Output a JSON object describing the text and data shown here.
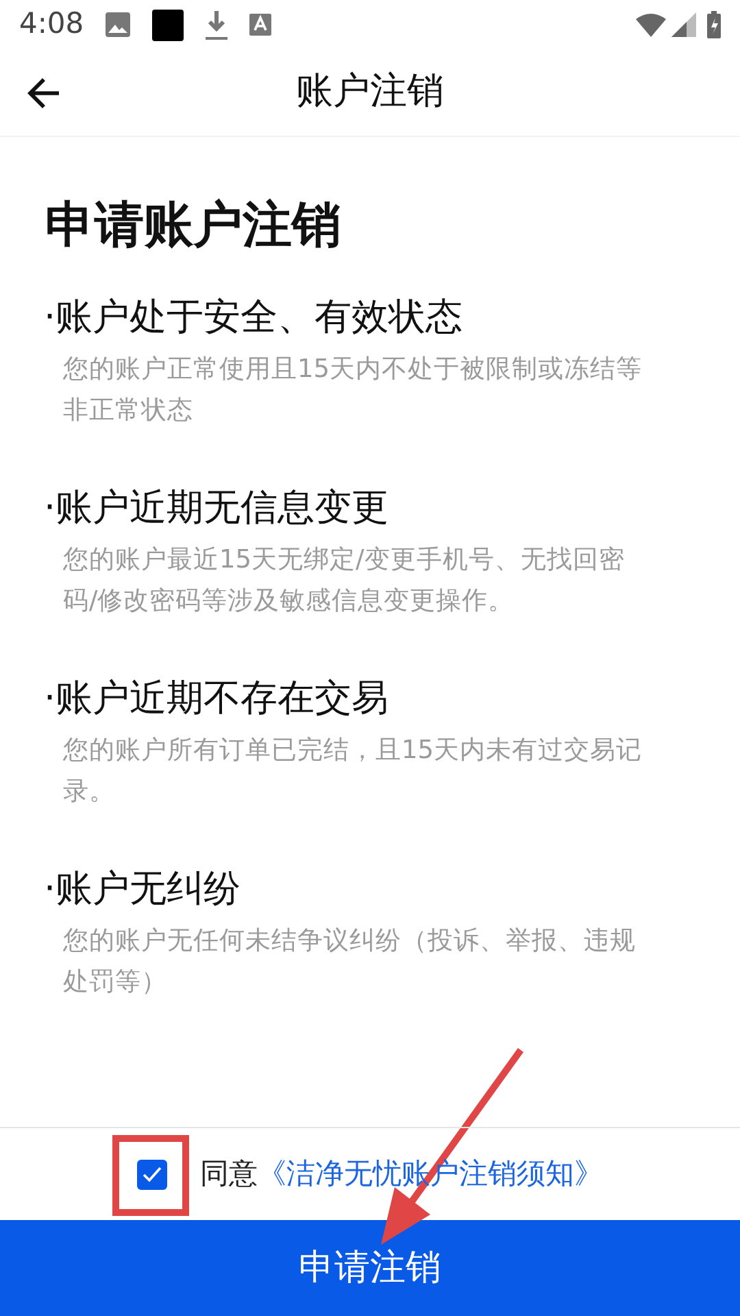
{
  "status_bar": {
    "time": "4:08"
  },
  "nav": {
    "title": "账户注销"
  },
  "heading": "申请账户注销",
  "conditions": [
    {
      "title": "·账户处于安全、有效状态",
      "description": "您的账户正常使用且15天内不处于被限制或冻结等非正常状态"
    },
    {
      "title": "·账户近期无信息变更",
      "description": "您的账户最近15天无绑定/变更手机号、无找回密码/修改密码等涉及敏感信息变更操作。"
    },
    {
      "title": "·账户近期不存在交易",
      "description": "您的账户所有订单已完结，且15天内未有过交易记录。"
    },
    {
      "title": "·账户无纠纷",
      "description": "您的账户无任何未结争议纠纷（投诉、举报、违规处罚等）"
    }
  ],
  "agreement": {
    "checked": true,
    "label": "同意",
    "link": "《洁净无忧账户注销须知》"
  },
  "submit_button": "申请注销"
}
